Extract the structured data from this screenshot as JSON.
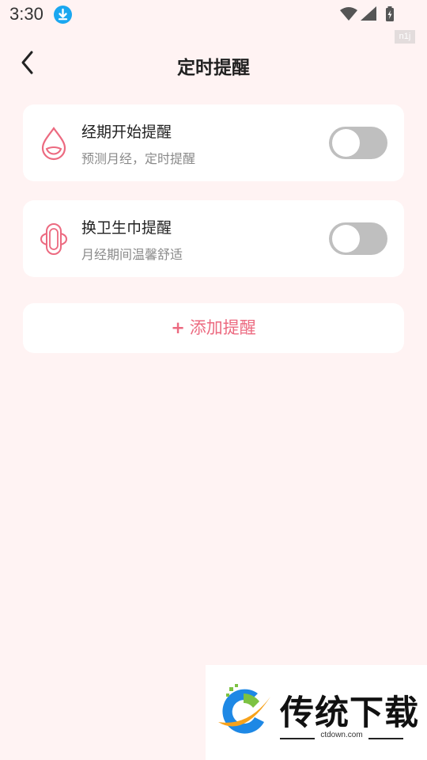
{
  "status_bar": {
    "time": "3:30",
    "icons": [
      "download-icon",
      "wifi-icon",
      "signal-icon",
      "battery-charging-icon"
    ],
    "badge_text": "n1j"
  },
  "header": {
    "title": "定时提醒",
    "back_icon": "chevron-left-icon"
  },
  "reminders": [
    {
      "icon": "drop-icon",
      "title": "经期开始提醒",
      "subtitle": "预测月经，定时提醒",
      "enabled": false
    },
    {
      "icon": "sanitary-pad-icon",
      "title": "换卫生巾提醒",
      "subtitle": "月经期间温馨舒适",
      "enabled": false
    }
  ],
  "add_button": {
    "plus": "+",
    "label": "添加提醒"
  },
  "watermark": {
    "title": "传统下载",
    "url": "ctdown.com"
  },
  "colors": {
    "background": "#fff3f3",
    "card": "#ffffff",
    "accent": "#ec6a80",
    "toggle_off": "#bfbfbf",
    "download_badge": "#1aa7f0"
  }
}
